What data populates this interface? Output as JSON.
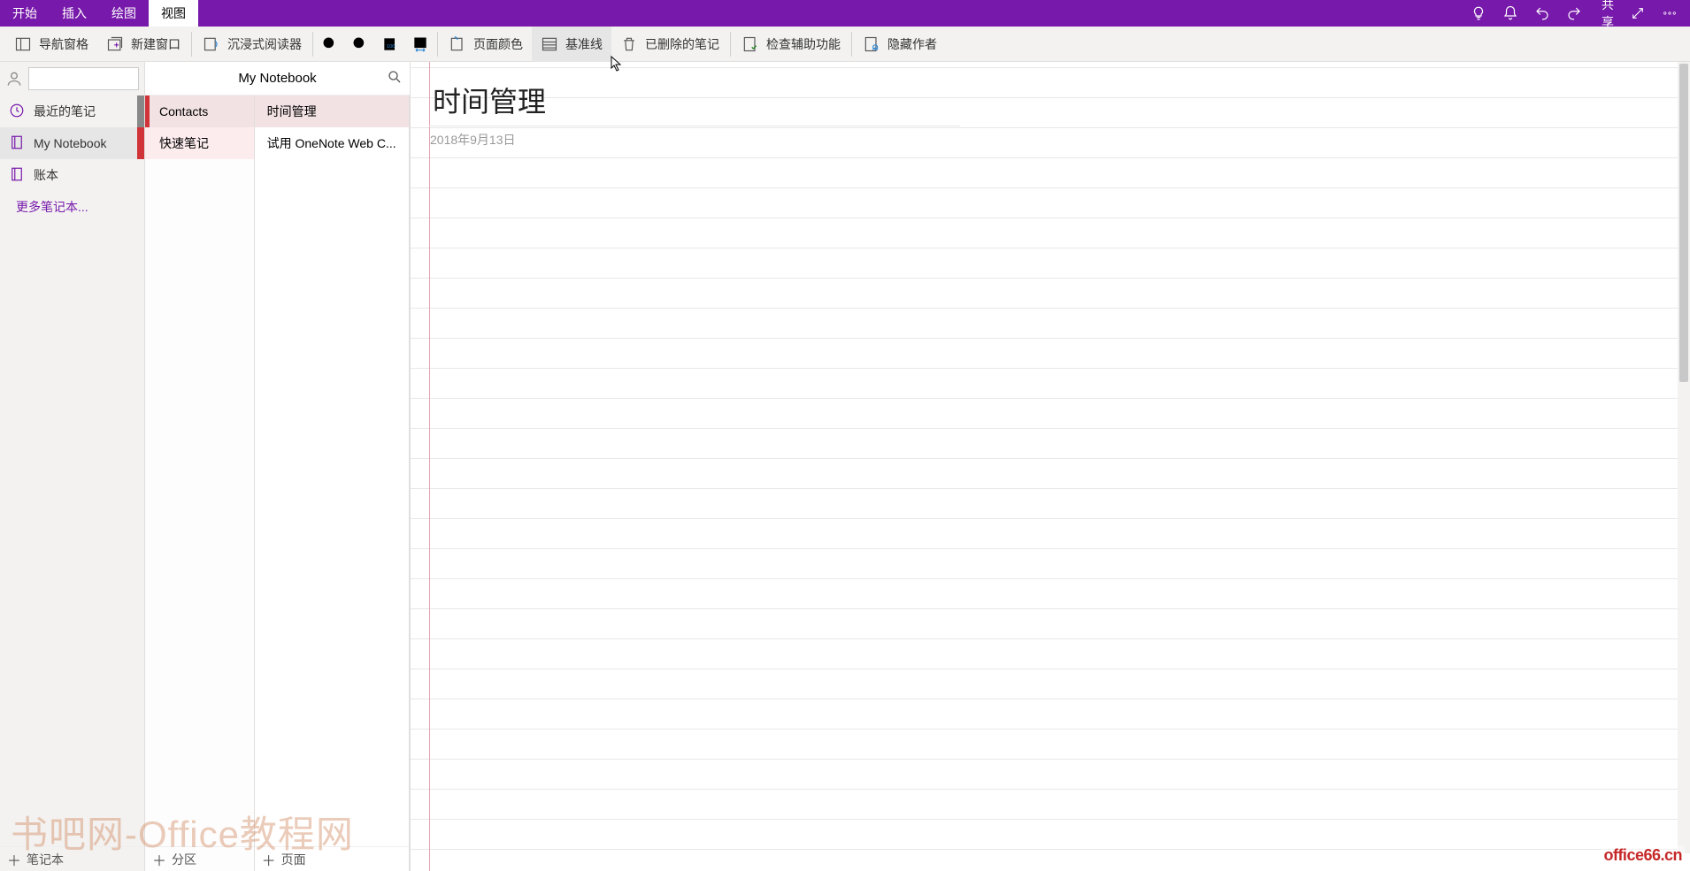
{
  "tabs": {
    "start": "开始",
    "insert": "插入",
    "draw": "绘图",
    "view": "视图"
  },
  "titlebar": {
    "share": "共享"
  },
  "ribbon": {
    "navpane": "导航窗格",
    "newwindow": "新建窗口",
    "immersive": "沉浸式阅读器",
    "pagecolor": "页面颜色",
    "ruleLines": "基准线",
    "deletedNotes": "已删除的笔记",
    "accessibility": "检查辅助功能",
    "hideAuthors": "隐藏作者"
  },
  "sidebar": {
    "recent": "最近的笔记",
    "notebook": "My Notebook",
    "ledger": "账本",
    "more": "更多笔记本..."
  },
  "header": {
    "notebookName": "My Notebook"
  },
  "sections": {
    "contacts": "Contacts",
    "quicknotes": "快速笔记"
  },
  "pages": {
    "timeManagement": "时间管理",
    "tryWeb": "试用 OneNote Web C..."
  },
  "canvas": {
    "title": "时间管理",
    "date": "2018年9月13日"
  },
  "add": {
    "notebook": "笔记本",
    "section": "分区",
    "page": "页面"
  },
  "watermark": {
    "left": "书吧网-Office教程网",
    "right": "office66.cn"
  }
}
